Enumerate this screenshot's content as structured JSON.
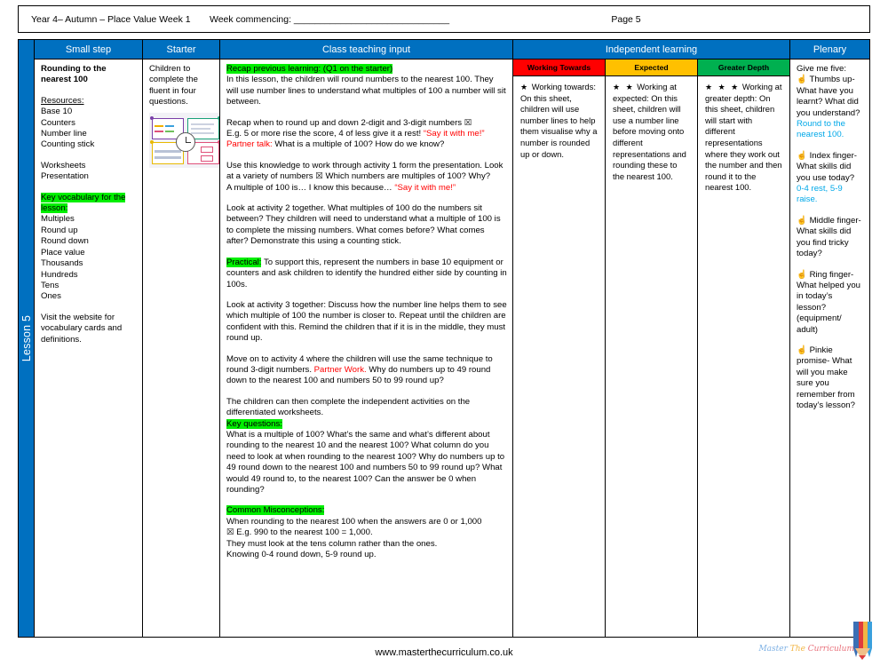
{
  "header": {
    "left": "Year 4– Autumn – Place Value Week 1",
    "week_commencing": "Week commencing: ______________________________",
    "page": "Page 5"
  },
  "lesson_spine": "Lesson 5",
  "columns": {
    "small_step": "Small step",
    "starter": "Starter",
    "class_teaching_input": "Class teaching input",
    "independent_learning": "Independent learning",
    "plenary": "Plenary"
  },
  "colors": {
    "header_blue": "#0070C0",
    "working_towards_red": "#FF0000",
    "expected_amber": "#FFC000",
    "greater_depth_green": "#00B050",
    "highlight_green": "#00EE00",
    "accent_red_text": "#FF0000",
    "accent_blue_text": "#00A8E8"
  },
  "small_step": {
    "title": "Rounding to the nearest 100",
    "resources_label": "Resources:",
    "resources": [
      "Base 10",
      "Counters",
      "Number line",
      "Counting stick"
    ],
    "materials": [
      "Worksheets",
      "Presentation"
    ],
    "key_vocab_label": "Key vocabulary for the lesson:",
    "key_vocab": [
      "Multiples",
      "Round up",
      "Round down",
      "Place value",
      "Thousands",
      "Hundreds",
      "Tens",
      "Ones"
    ],
    "website_note": "Visit the website for vocabulary cards and definitions."
  },
  "starter": {
    "text": "Children to complete the fluent in four questions.",
    "thumbnail_alt": "fluent-in-four-worksheet-thumbnail"
  },
  "teaching": {
    "recap_label": "Recap previous learning: (Q1 on the starter)",
    "p1": "In this lesson, the children will round numbers to the nearest 100. They will use number lines to understand what multiples of 100 a number will sit between.",
    "p2_a": "Recap when to round up and down 2-digit and 3-digit numbers ☒",
    "p2_b": "E.g. 5 or more rise the score, 4 of less give it a rest! ",
    "p2_red": "“Say it with me!”",
    "p3_red": "Partner talk:",
    "p3": " What is a multiple of 100? How do we know?",
    "p4": "Use this knowledge to work through activity 1 form the presentation. Look at a variety of numbers ☒ Which numbers are multiples of 100? Why?",
    "p5": "A multiple of 100 is… I know this because…  ",
    "p5_red": "“Say it with me!”",
    "p6": "Look at activity 2 together. What multiples of 100 do the numbers sit between? They children will need to understand what a multiple of 100 is to complete the missing numbers. What comes before? What comes after? Demonstrate this using a counting stick.",
    "practical_label": "Practical:",
    "p7": " To support this, represent the numbers in base 10 equipment or counters and ask children to identify the hundred either side by counting in 100s.",
    "p8": "Look at activity 3 together: Discuss how the number line helps them to see which multiple of 100 the number is closer to. Repeat until the children are confident with this. Remind the children that if it is in the middle, they must round up.",
    "p9_a": "Move on to activity 4 where the children will use the same technique to round 3-digit numbers. ",
    "p9_red": "Partner Work.",
    "p9_b": " Why do numbers up to 49 round down to the nearest 100  and numbers 50 to 99 round up?",
    "p10": "The children can then complete the independent activities on the differentiated worksheets.",
    "key_questions_label": "Key questions:",
    "p11": "What is a multiple of 100? What’s the same and what’s different about rounding to the nearest 10 and the nearest 100? What column do you need to look at when rounding to the nearest 100? Why do numbers up to 49 round down to the nearest 100 and numbers 50 to 99 round up? What would 49 round to, to the nearest 100? Can the answer be 0 when rounding?",
    "misconceptions_label": "Common Misconceptions:",
    "p12_l1": "When rounding to the nearest 100 when the answers are 0 or 1,000",
    "p12_l2": "☒ E.g. 990 to the nearest 100 = 1,000.",
    "p12_l3": "They must look at the tens column rather than the ones.",
    "p12_l4": "Knowing 0-4 round down, 5-9 round up."
  },
  "independent": [
    {
      "label": "Working Towards",
      "color": "#FF0000",
      "stars": "★",
      "heading": "Working towards:",
      "text": "On this sheet, children will use number lines to help them visualise why a number is rounded up or down."
    },
    {
      "label": "Expected",
      "color": "#FFC000",
      "stars": "★ ★",
      "heading": "Working at expected:",
      "text": "On this sheet, children will use a number line before moving onto different representations and rounding these to the nearest 100."
    },
    {
      "label": "Greater Depth",
      "color": "#00B050",
      "stars": "★ ★ ★",
      "heading": "Working at greater depth:",
      "text": "On this sheet, children will start with different representations where they work out the number and then round it to the nearest 100."
    }
  ],
  "plenary": {
    "intro": "Give me five:",
    "items": [
      {
        "icon": "☝",
        "question": "Thumbs up- What have you learnt? What did you understand?",
        "answer": "Round to the nearest 100."
      },
      {
        "icon": "☝",
        "question": "Index finger- What skills did you use today?",
        "answer": "0-4 rest, 5-9 raise."
      },
      {
        "icon": "☝",
        "question": "Middle finger- What skills did you find tricky today?",
        "answer": ""
      },
      {
        "icon": "☝",
        "question": "Ring finger- What helped you in today’s lesson? (equipment/ adult)",
        "answer": ""
      },
      {
        "icon": "☝",
        "question": "Pinkie promise- What will you make sure you remember from today’s lesson?",
        "answer": ""
      }
    ]
  },
  "footer": {
    "url": "www.masterthecurriculum.co.uk",
    "logo_text_1": "Master",
    "logo_text_2": "The",
    "logo_text_3": "Curriculum"
  }
}
